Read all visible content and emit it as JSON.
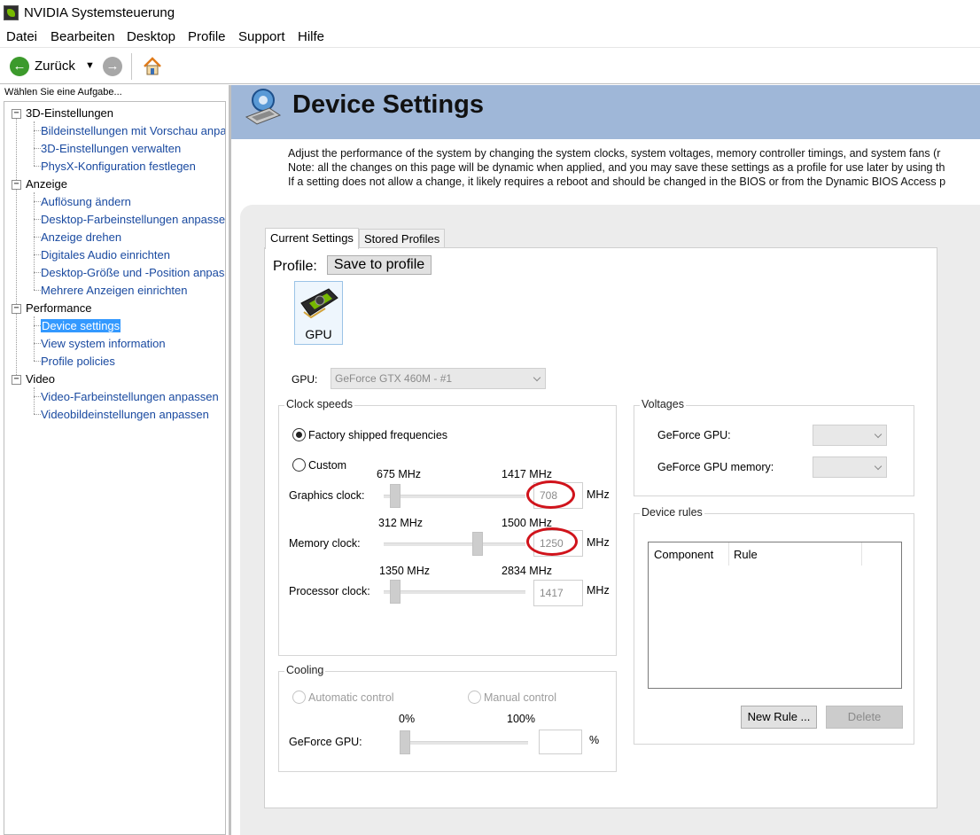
{
  "window": {
    "title": "NVIDIA Systemsteuerung"
  },
  "menu": [
    "Datei",
    "Bearbeiten",
    "Desktop",
    "Profile",
    "Support",
    "Hilfe"
  ],
  "toolbar": {
    "back_label": "Zurück"
  },
  "sidebar": {
    "heading": "Wählen Sie eine Aufgabe...",
    "tree": [
      {
        "label": "3D-Einstellungen",
        "expander": "−",
        "items": [
          "Bildeinstellungen mit Vorschau anpassen",
          "3D-Einstellungen verwalten",
          "PhysX-Konfiguration festlegen"
        ]
      },
      {
        "label": "Anzeige",
        "expander": "−",
        "items": [
          "Auflösung ändern",
          "Desktop-Farbeinstellungen anpassen",
          "Anzeige drehen",
          "Digitales Audio einrichten",
          "Desktop-Größe und -Position anpassen",
          "Mehrere Anzeigen einrichten"
        ]
      },
      {
        "label": "Performance",
        "expander": "−",
        "items": [
          "Device settings",
          "View system information",
          "Profile policies"
        ]
      },
      {
        "label": "Video",
        "expander": "−",
        "items": [
          "Video-Farbeinstellungen anpassen",
          "Videobildeinstellungen anpassen"
        ]
      }
    ],
    "selected": "Device settings"
  },
  "header": {
    "title": "Device Settings"
  },
  "description": [
    "Adjust the performance of the system by changing the system clocks, system voltages,  memory controller timings, and system fans (r",
    "Note: all the changes on this page will be dynamic when applied, and you may save these settings as a profile for use later by using th",
    "If a setting does not allow a change, it likely requires a reboot and should be changed in the BIOS or from the Dynamic BIOS Access p"
  ],
  "tabs": [
    "Current Settings",
    "Stored Profiles"
  ],
  "profile": {
    "label": "Profile:",
    "save_label": "Save to profile"
  },
  "gpu_tile": {
    "label": "GPU"
  },
  "gpu_select": {
    "label": "GPU:",
    "value": "GeForce GTX 460M - #1"
  },
  "clock_speeds": {
    "title": "Clock speeds",
    "factory_label": "Factory shipped frequencies",
    "custom_label": "Custom",
    "selected": "factory",
    "unit": "MHz",
    "graphics": {
      "label": "Graphics clock:",
      "min": "675 MHz",
      "max": "1417 MHz",
      "value": "708"
    },
    "memory": {
      "label": "Memory clock:",
      "min": "312 MHz",
      "max": "1500 MHz",
      "value": "1250"
    },
    "processor": {
      "label": "Processor clock:",
      "min": "1350 MHz",
      "max": "2834 MHz",
      "value": "1417"
    }
  },
  "voltages": {
    "title": "Voltages",
    "gpu_label": "GeForce GPU:",
    "memory_label": "GeForce GPU memory:"
  },
  "device_rules": {
    "title": "Device rules",
    "columns": [
      "Component",
      "Rule"
    ],
    "new_rule": "New Rule ...",
    "delete": "Delete"
  },
  "cooling": {
    "title": "Cooling",
    "automatic_label": "Automatic control",
    "manual_label": "Manual control",
    "min": "0%",
    "max": "100%",
    "gpu_label": "GeForce GPU:",
    "unit": "%"
  },
  "colors": {
    "accent": "#3399ff",
    "header_band": "#9fb7d8",
    "highlight": "#d0131b"
  }
}
